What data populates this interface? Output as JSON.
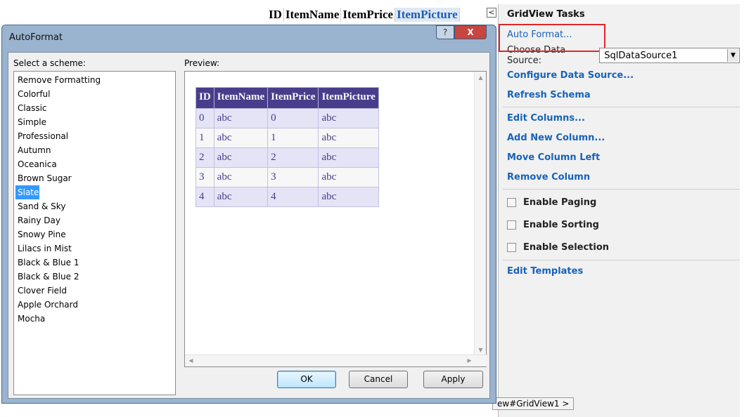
{
  "background": {
    "grid_headers": [
      "ID",
      "ItemName",
      "ItemPrice",
      "ItemPicture"
    ],
    "selected_header": "ItemPicture",
    "smarttag_glyph": "<",
    "bottom_tab": "ew#GridView1 >"
  },
  "tasks": {
    "title": "GridView Tasks",
    "auto_format": "Auto Format...",
    "data_source_label": "Choose Data Source:",
    "data_source_value": "SqlDataSource1",
    "links_a": [
      "Configure Data Source...",
      "Refresh Schema"
    ],
    "links_b": [
      "Edit Columns...",
      "Add New Column...",
      "Move Column Left",
      "Remove Column"
    ],
    "checkboxes": [
      {
        "label": "Enable Paging",
        "checked": false
      },
      {
        "label": "Enable Sorting",
        "checked": false
      },
      {
        "label": "Enable Selection",
        "checked": false
      }
    ],
    "edit_templates": "Edit Templates",
    "highlight_color": "#e0262b"
  },
  "dialog": {
    "title": "AutoFormat",
    "help_glyph": "?",
    "close_glyph": "X",
    "select_label": "Select a scheme:",
    "preview_label": "Preview:",
    "schemes": [
      "Remove Formatting",
      "Colorful",
      "Classic",
      "Simple",
      "Professional",
      "Autumn",
      "Oceanica",
      "Brown Sugar",
      "Slate",
      "Sand & Sky",
      "Rainy Day",
      "Snowy Pine",
      "Lilacs in Mist",
      "Black & Blue 1",
      "Black & Blue 2",
      "Clover Field",
      "Apple Orchard",
      "Mocha"
    ],
    "selected_scheme": "Slate",
    "preview_table": {
      "headers": [
        "ID",
        "ItemName",
        "ItemPrice",
        "ItemPicture"
      ],
      "rows": [
        [
          "0",
          "abc",
          "0",
          "abc"
        ],
        [
          "1",
          "abc",
          "1",
          "abc"
        ],
        [
          "2",
          "abc",
          "2",
          "abc"
        ],
        [
          "3",
          "abc",
          "3",
          "abc"
        ],
        [
          "4",
          "abc",
          "4",
          "abc"
        ]
      ],
      "header_color": "#483d8b",
      "alt_row_color": "#e5e3f6"
    },
    "buttons": {
      "ok": "OK",
      "cancel": "Cancel",
      "apply": "Apply"
    }
  }
}
